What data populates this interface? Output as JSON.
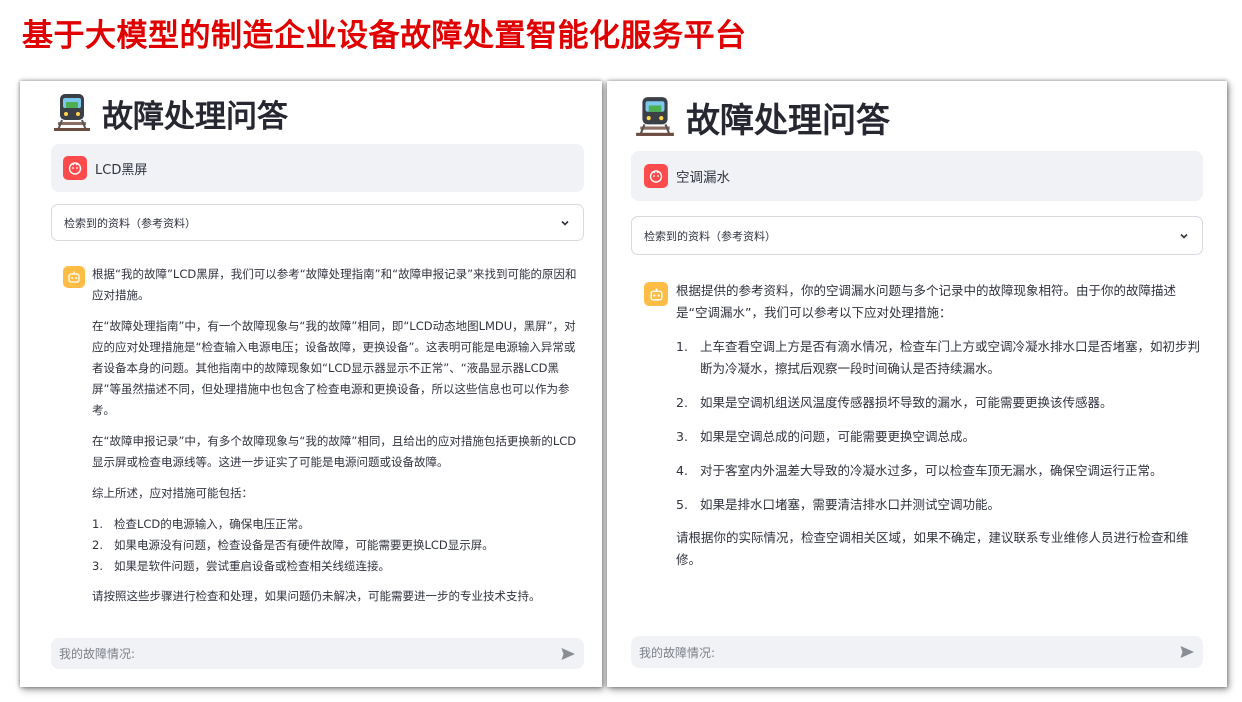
{
  "slide_title": "基于大模型的制造企业设备故障处置智能化服务平台",
  "left": {
    "app_title": "故障处理问答",
    "user_message": "LCD黑屏",
    "expander_label": "检索到的资料（参考资料）",
    "answer": {
      "p1": "根据“我的故障”LCD黑屏，我们可以参考“故障处理指南”和“故障申报记录”来找到可能的原因和应对措施。",
      "p2": "在“故障处理指南”中，有一个故障现象与“我的故障”相同，即“LCD动态地图LMDU，黑屏”，对应的应对处理措施是“检查输入电源电压；设备故障，更换设备”。这表明可能是电源输入异常或者设备本身的问题。其他指南中的故障现象如“LCD显示器显示不正常”、“液晶显示器LCD黑屏”等虽然描述不同，但处理措施中也包含了检查电源和更换设备，所以这些信息也可以作为参考。",
      "p3": "在“故障申报记录”中，有多个故障现象与“我的故障”相同，且给出的应对措施包括更换新的LCD显示屏或检查电源线等。这进一步证实了可能是电源问题或设备故障。",
      "p4": "综上所述，应对措施可能包括：",
      "list": [
        {
          "n": "1.",
          "t": "检查LCD的电源输入，确保电压正常。"
        },
        {
          "n": "2.",
          "t": "如果电源没有问题，检查设备是否有硬件故障，可能需要更换LCD显示屏。"
        },
        {
          "n": "3.",
          "t": "如果是软件问题，尝试重启设备或检查相关线缆连接。"
        }
      ],
      "p5": "请按照这些步骤进行检查和处理，如果问题仍未解决，可能需要进一步的专业技术支持。"
    },
    "input_placeholder": "我的故障情况:"
  },
  "right": {
    "app_title": "故障处理问答",
    "user_message": "空调漏水",
    "expander_label": "检索到的资料（参考资料）",
    "answer": {
      "p1": "根据提供的参考资料，你的空调漏水问题与多个记录中的故障现象相符。由于你的故障描述是“空调漏水”，我们可以参考以下应对处理措施：",
      "list": [
        {
          "n": "1.",
          "t": "上车查看空调上方是否有滴水情况，检查车门上方或空调冷凝水排水口是否堵塞，如初步判断为冷凝水，擦拭后观察一段时间确认是否持续漏水。"
        },
        {
          "n": "2.",
          "t": "如果是空调机组送风温度传感器损坏导致的漏水，可能需要更换该传感器。"
        },
        {
          "n": "3.",
          "t": "如果是空调总成的问题，可能需要更换空调总成。"
        },
        {
          "n": "4.",
          "t": "对于客室内外温差大导致的冷凝水过多，可以检查车顶无漏水，确保空调运行正常。"
        },
        {
          "n": "5.",
          "t": "如果是排水口堵塞，需要清洁排水口并测试空调功能。"
        }
      ],
      "p2": "请根据你的实际情况，检查空调相关区域，如果不确定，建议联系专业维修人员进行检查和维修。"
    },
    "input_placeholder": "我的故障情况:"
  },
  "colors": {
    "title_red": "#e00000",
    "user_avatar": "#ff4b4b",
    "bot_avatar": "#ffbd45",
    "input_bg": "#f0f2f6"
  },
  "icons": [
    "train-icon",
    "user-avatar-icon",
    "bot-avatar-icon",
    "chevron-down-icon",
    "send-icon"
  ]
}
